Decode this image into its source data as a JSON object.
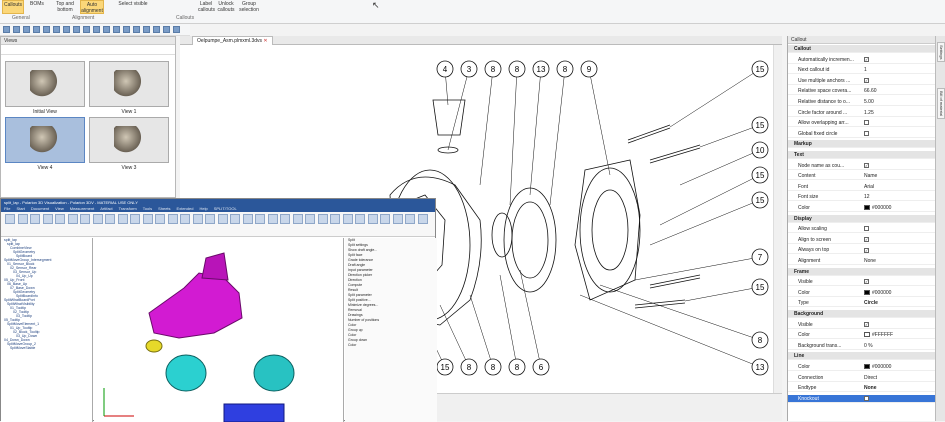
{
  "ribbon": {
    "buttons": [
      {
        "label": "Callouts",
        "active": true
      },
      {
        "label": "BOMs",
        "active": false
      },
      {
        "label": "Top and bottom",
        "active": false
      },
      {
        "label": "Auto alignment",
        "active": true
      },
      {
        "label": "Select visible",
        "active": false
      },
      {
        "label": "Label callouts",
        "active": false
      },
      {
        "label": "Unlock callouts",
        "active": false
      },
      {
        "label": "Group selection",
        "active": false
      }
    ],
    "groups": [
      "General",
      "Alignment",
      "Callouts"
    ]
  },
  "views_panel": {
    "title": "Views",
    "items": [
      {
        "label": "Initial View",
        "selected": false
      },
      {
        "label": "View 1",
        "selected": false
      },
      {
        "label": "View 4",
        "selected": true
      },
      {
        "label": "View 3",
        "selected": false
      }
    ]
  },
  "document": {
    "tab": "Oelpumpe_Asm.plmxml.3dvs"
  },
  "drawing": {
    "callouts": [
      "4",
      "3",
      "8",
      "8",
      "13",
      "8",
      "9",
      "15",
      "15",
      "10",
      "15",
      "15",
      "7",
      "15",
      "8",
      "13",
      "15",
      "8",
      "8",
      "8",
      "6"
    ]
  },
  "properties": {
    "title": "Callout",
    "rows": [
      {
        "type": "section",
        "key": "Callout"
      },
      {
        "type": "row",
        "key": "Automatically incremen...",
        "value": "",
        "check": true
      },
      {
        "type": "row",
        "key": "Next callout id",
        "value": "1"
      },
      {
        "type": "row",
        "key": "Use multiple anchors ...",
        "value": "",
        "check": true
      },
      {
        "type": "row",
        "key": "Relative space covera...",
        "value": "66.60"
      },
      {
        "type": "row",
        "key": "Relative distance to o...",
        "value": "5.00"
      },
      {
        "type": "row",
        "key": "Circle factor around ...",
        "value": "1.25"
      },
      {
        "type": "row",
        "key": "Allow overlapping arr...",
        "value": "",
        "check": false
      },
      {
        "type": "row",
        "key": "Global fixed circle",
        "value": "",
        "check": false
      },
      {
        "type": "section",
        "key": "Markup"
      },
      {
        "type": "section",
        "key": "Text"
      },
      {
        "type": "row",
        "key": "Node name as cou...",
        "value": "",
        "check": true
      },
      {
        "type": "row",
        "key": "Content",
        "value": "Name"
      },
      {
        "type": "row",
        "key": "Font",
        "value": "Arial"
      },
      {
        "type": "row",
        "key": "Font size",
        "value": "12"
      },
      {
        "type": "row",
        "key": "Color",
        "value": "#000000",
        "swatch": "#000000"
      },
      {
        "type": "section",
        "key": "Display"
      },
      {
        "type": "row",
        "key": "Allow scaling",
        "value": "",
        "check": false
      },
      {
        "type": "row",
        "key": "Align to screen",
        "value": "",
        "check": true
      },
      {
        "type": "row",
        "key": "Always on top",
        "value": "",
        "check": true
      },
      {
        "type": "row",
        "key": "Alignment",
        "value": "None"
      },
      {
        "type": "section",
        "key": "Frame"
      },
      {
        "type": "row",
        "key": "Visible",
        "value": "",
        "check": true
      },
      {
        "type": "row",
        "key": "Color",
        "value": "#000000",
        "swatch": "#000000"
      },
      {
        "type": "row",
        "key": "Type",
        "value": "Circle",
        "bold": true
      },
      {
        "type": "section",
        "key": "Background"
      },
      {
        "type": "row",
        "key": "Visible",
        "value": "",
        "check": true
      },
      {
        "type": "row",
        "key": "Color",
        "value": "#FFFFFF",
        "swatch": "#FFFFFF"
      },
      {
        "type": "row",
        "key": "Background trans...",
        "value": "0 %"
      },
      {
        "type": "section",
        "key": "Line"
      },
      {
        "type": "row",
        "key": "Color",
        "value": "#000000",
        "swatch": "#000000"
      },
      {
        "type": "row",
        "key": "Connection",
        "value": "Direct"
      },
      {
        "type": "row",
        "key": "Endtype",
        "value": "None",
        "bold": true
      },
      {
        "type": "row",
        "key": "Knockout",
        "value": "",
        "check": true,
        "selected": true
      }
    ]
  },
  "side_tabs": [
    "Settings",
    "Bill of material"
  ],
  "inset": {
    "title": "split_lap - Polarion 3D Visualization - Polarion 3DV - MATERIAL USE ONLY",
    "menu": [
      "File",
      "Start",
      "Document",
      "View",
      "Measurement",
      "Artifact",
      "Transform",
      "Tools",
      "Sheets",
      "Extended",
      "Help",
      "SPLIT/TOOL"
    ],
    "tree": [
      "split_lap",
      "split_lap",
      "CombineView",
      "SplitGeometry",
      "SplitBoard",
      "SplitMoveGroup_Intersegment",
      "01_Sensor_Block",
      "02_Sensor_Rear",
      "03_Sensor_Up",
      "04_Up_Up",
      "05_Up_Front",
      "06_Base_Up",
      "07_Base_Down",
      "SplitGeometry",
      "SplitBoardInfo",
      "SplitWhatBoardPort",
      "SplitWhatVisibility",
      "01_Tooltip",
      "02_Tooltip",
      "03_Tooltip",
      "05_Tooltip",
      "SplitMoveElement_1",
      "01_Up_Tooltip",
      "02_Block_Tooltip",
      "03_Up_Down",
      "04_Down_Down",
      "SplitMoveGroup_2",
      "SplitMoveStable"
    ],
    "split": [
      "Split",
      "Split settings",
      "Show draft angle...",
      "Split face",
      "Grade tolerance",
      "Draft angle",
      "Input parameter",
      "Direction picker",
      "Direction",
      "Compute",
      "Result",
      "Split parameter",
      "Split positive...",
      "Minimize degrees...",
      "Removal",
      "Drawings",
      "Number of positions",
      "Color",
      "Group up",
      "Color",
      "Group down",
      "Color"
    ]
  }
}
